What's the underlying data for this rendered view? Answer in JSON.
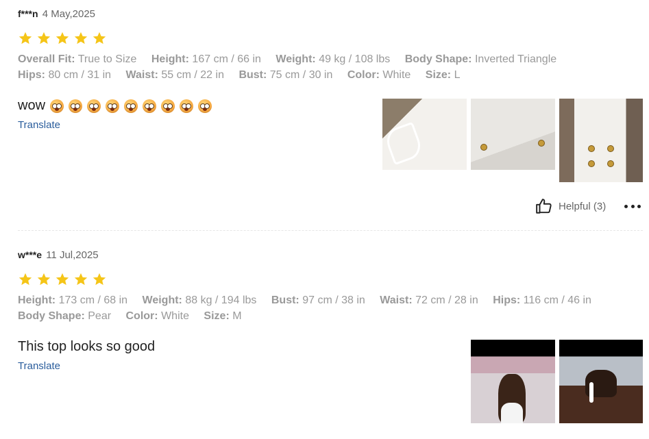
{
  "reviews": [
    {
      "username": "f***n",
      "date": "4 May,2025",
      "rating": 5,
      "attributes_row1": [
        {
          "key": "Overall Fit:",
          "value": "True to Size"
        },
        {
          "key": "Height:",
          "value": "167 cm / 66 in"
        },
        {
          "key": "Weight:",
          "value": "49 kg / 108 lbs"
        },
        {
          "key": "Body Shape:",
          "value": "Inverted Triangle"
        }
      ],
      "attributes_row2": [
        {
          "key": "Hips:",
          "value": "80 cm / 31 in"
        },
        {
          "key": "Waist:",
          "value": "55 cm / 22 in"
        },
        {
          "key": "Bust:",
          "value": "75 cm / 30 in"
        },
        {
          "key": "Color:",
          "value": "White"
        },
        {
          "key": "Size:",
          "value": "L"
        }
      ],
      "comment": "wow",
      "emoji_count": 9,
      "translate_label": "Translate",
      "photo_count": 3,
      "helpful_label": "Helpful (3)"
    },
    {
      "username": "w***e",
      "date": "11 Jul,2025",
      "rating": 5,
      "attributes_row1": [
        {
          "key": "Height:",
          "value": "173 cm / 68 in"
        },
        {
          "key": "Weight:",
          "value": "88 kg / 194 lbs"
        },
        {
          "key": "Bust:",
          "value": "97 cm / 38 in"
        },
        {
          "key": "Waist:",
          "value": "72 cm / 28 in"
        },
        {
          "key": "Hips:",
          "value": "116 cm / 46 in"
        }
      ],
      "attributes_row2": [
        {
          "key": "Body Shape:",
          "value": "Pear"
        },
        {
          "key": "Color:",
          "value": "White"
        },
        {
          "key": "Size:",
          "value": "M"
        }
      ],
      "comment": "This top looks so good",
      "translate_label": "Translate",
      "photo_count": 2
    }
  ],
  "colors": {
    "star": "#f5c518",
    "link": "#2a5d9c",
    "muted": "#999999"
  },
  "icons": {
    "star": "star-icon",
    "thumb": "thumbs-up-icon",
    "more": "more-dots-icon",
    "emoji": "flushed-face-emoji"
  }
}
